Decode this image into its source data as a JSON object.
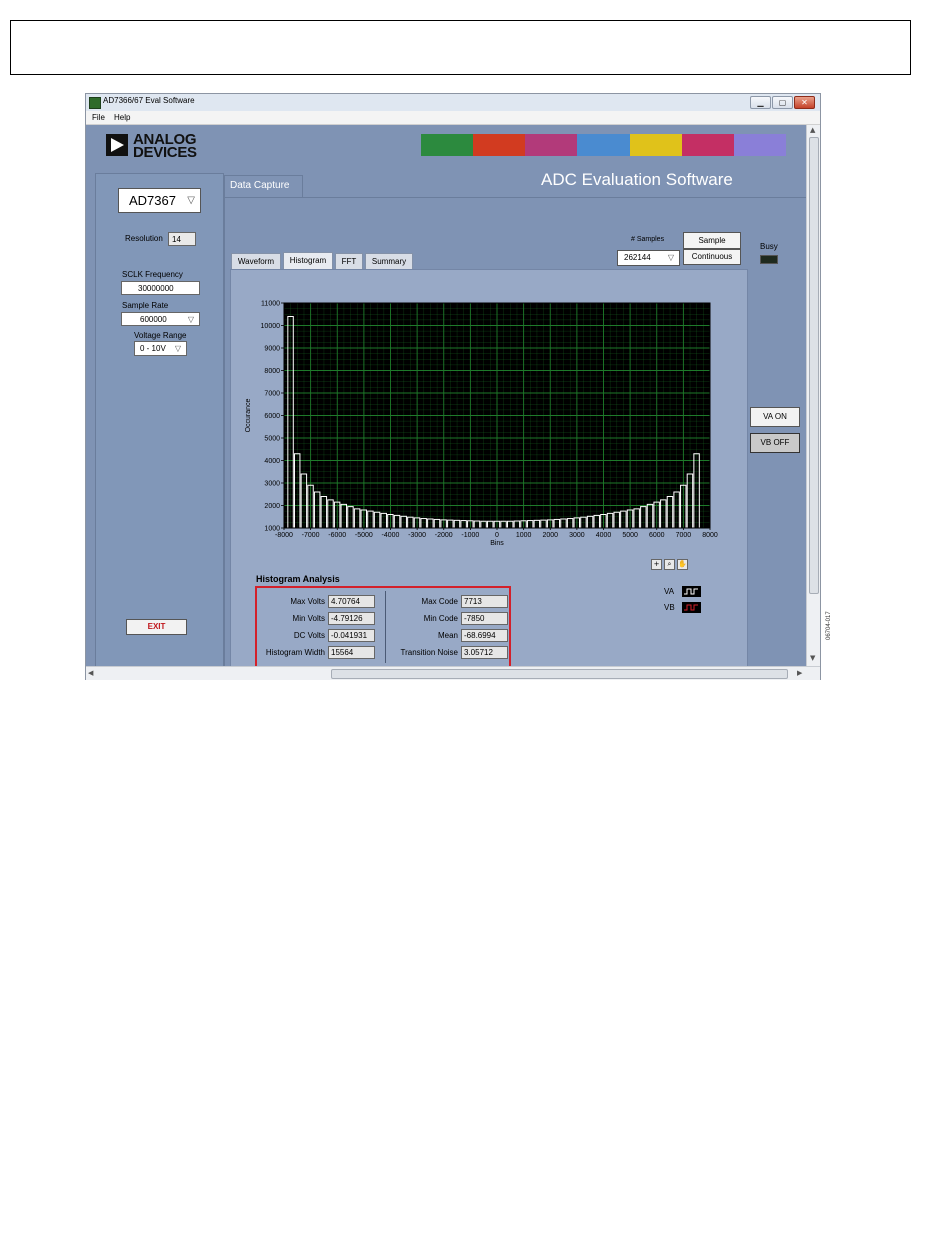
{
  "window": {
    "title": "AD7366/67 Eval Software",
    "minimize": "▁",
    "maximize": "▢",
    "close": "✕"
  },
  "menu": {
    "file": "File",
    "help": "Help"
  },
  "header": {
    "logo_line1": "ANALOG",
    "logo_line2": "DEVICES",
    "app_title": "ADC Evaluation Software",
    "banner_colors": [
      "#2c8a3e",
      "#d23b20",
      "#b23a7a",
      "#4a8bd0",
      "#e0c21a",
      "#c42f64",
      "#8a7fd8"
    ]
  },
  "left_panel": {
    "device": "AD7367",
    "resolution_label": "Resolution",
    "resolution_value": "14",
    "sclk_label": "SCLK Frequency",
    "sclk_value": "30000000",
    "sample_rate_label": "Sample Rate",
    "sample_rate_value": "600000",
    "voltage_range_label": "Voltage Range",
    "voltage_range_value": "0 - 10V",
    "exit_label": "EXIT"
  },
  "main": {
    "main_tab": "Data Capture",
    "subtabs": [
      "Waveform",
      "Histogram",
      "FFT",
      "Summary"
    ],
    "active_subtab": "Histogram",
    "samples_label": "# Samples",
    "samples_value": "262144",
    "sample_button": "Sample",
    "continuous_button": "Continuous",
    "busy_label": "Busy",
    "va_button": "VA ON",
    "vb_button": "VB OFF",
    "va_label": "VA",
    "vb_label": "VB",
    "va_color": "#ffffff",
    "vb_color": "#d3202a"
  },
  "analysis": {
    "title": "Histogram Analysis",
    "max_volts_label": "Max Volts",
    "max_volts": "4.70764",
    "min_volts_label": "Min Volts",
    "min_volts": "-4.79126",
    "dc_volts_label": "DC Volts",
    "dc_volts": "-0.041931",
    "hist_width_label": "Histogram Width",
    "hist_width": "15564",
    "max_code_label": "Max Code",
    "max_code": "7713",
    "min_code_label": "Min Code",
    "min_code": "-7850",
    "mean_label": "Mean",
    "mean": "-68.6994",
    "transition_noise_label": "Transition Noise",
    "transition_noise": "3.05712",
    "callout": "1"
  },
  "figure_id": "06704-017",
  "chart_data": {
    "type": "bar",
    "xlabel": "Bins",
    "ylabel": "Occurance",
    "xlim": [
      -8000,
      8000
    ],
    "ylim": [
      1000,
      11000
    ],
    "x_ticks": [
      -8000,
      -7000,
      -6000,
      -5000,
      -4000,
      -3000,
      -2000,
      -1000,
      0,
      1000,
      2000,
      3000,
      4000,
      5000,
      6000,
      7000,
      8000
    ],
    "y_ticks": [
      1000,
      2000,
      3000,
      4000,
      5000,
      6000,
      7000,
      8000,
      9000,
      10000,
      11000
    ],
    "x_tick_labels": [
      "-8000",
      "-7000",
      "-6000",
      "-5000",
      "-4000",
      "-3000",
      "-2000",
      "-1000",
      "0",
      "1000",
      "2000",
      "3000",
      "4000",
      "5000",
      "6000",
      "7000",
      "8000"
    ],
    "y_tick_labels": [
      "1000",
      "2000",
      "3000",
      "4000",
      "5000",
      "6000",
      "7000",
      "8000",
      "9000",
      "10000",
      "11000"
    ],
    "bin_width": 250,
    "bins": [
      -7750,
      -7500,
      -7250,
      -7000,
      -6750,
      -6500,
      -6250,
      -6000,
      -5750,
      -5500,
      -5250,
      -5000,
      -4750,
      -4500,
      -4250,
      -4000,
      -3750,
      -3500,
      -3250,
      -3000,
      -2750,
      -2500,
      -2250,
      -2000,
      -1750,
      -1500,
      -1250,
      -1000,
      -750,
      -500,
      -250,
      0,
      250,
      500,
      750,
      1000,
      1250,
      1500,
      1750,
      2000,
      2250,
      2500,
      2750,
      3000,
      3250,
      3500,
      3750,
      4000,
      4250,
      4500,
      4750,
      5000,
      5250,
      5500,
      5750,
      6000,
      6250,
      6500,
      6750,
      7000,
      7250,
      7500
    ],
    "values": [
      10400,
      4300,
      3400,
      2900,
      2600,
      2400,
      2250,
      2150,
      2050,
      1950,
      1850,
      1800,
      1750,
      1700,
      1650,
      1600,
      1560,
      1520,
      1480,
      1450,
      1420,
      1400,
      1380,
      1360,
      1350,
      1340,
      1330,
      1320,
      1310,
      1300,
      1300,
      1300,
      1300,
      1300,
      1310,
      1320,
      1330,
      1340,
      1350,
      1360,
      1380,
      1400,
      1420,
      1450,
      1480,
      1520,
      1560,
      1600,
      1650,
      1700,
      1750,
      1800,
      1850,
      1950,
      2050,
      2150,
      2250,
      2400,
      2600,
      2900,
      3400,
      4300,
      10400
    ],
    "grid": true,
    "plot_background": "#000000",
    "grid_color": "#1e7a2a",
    "bar_color": "#ffffff"
  }
}
